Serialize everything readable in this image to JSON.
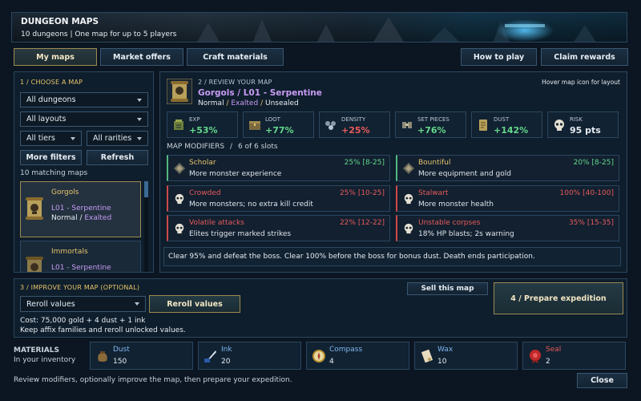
{
  "header": {
    "title": "DUNGEON MAPS",
    "subtitle": "10 dungeons | One map for up to 5 players"
  },
  "tabs": [
    {
      "label": "My maps",
      "active": true
    },
    {
      "label": "Market offers",
      "active": false
    },
    {
      "label": "Craft materials",
      "active": false
    }
  ],
  "top_actions": {
    "how_to_play": "How to play",
    "claim_rewards": "Claim rewards"
  },
  "choose": {
    "title": "1 / CHOOSE A MAP",
    "dungeons": "All dungeons",
    "layouts": "All layouts",
    "tiers": "All tiers",
    "rarities": "All rarities",
    "more_filters": "More filters",
    "refresh": "Refresh",
    "count": "10 matching maps",
    "maps": [
      {
        "name": "Gorgols",
        "layout": "L01 - Serpentine",
        "quality": "Normal",
        "sep": "/",
        "rarity": "Exalted",
        "selected": true
      },
      {
        "name": "Immortals",
        "layout": "L01 - Serpentine",
        "selected": false
      }
    ]
  },
  "review": {
    "title": "2 / REVIEW YOUR MAP",
    "hint": "Hover map icon for layout",
    "map_name": "Gorgols / L01 - Serpentine",
    "tags": [
      "Normal",
      "Exalted",
      "Unsealed"
    ],
    "sep": "/",
    "stats": [
      {
        "label": "EXP",
        "value": "+53%",
        "icon": "exp-icon"
      },
      {
        "label": "LOOT",
        "value": "+77%",
        "icon": "loot-icon"
      },
      {
        "label": "DENSITY",
        "value": "+25%",
        "icon": "density-icon"
      },
      {
        "label": "SET PIECES",
        "value": "+76%",
        "icon": "set-pieces-icon"
      },
      {
        "label": "DUST",
        "value": "+142%",
        "icon": "dust-icon"
      },
      {
        "label": "RISK",
        "value": "95 pts",
        "icon": "skull-icon"
      }
    ],
    "modifiers_title": "MAP MODIFIERS",
    "modifiers_slots": "6 of 6 slots",
    "modifiers": [
      {
        "name": "Scholar",
        "desc": "More monster experience",
        "range": "25% [8-25]",
        "kind": "good"
      },
      {
        "name": "Bountiful",
        "desc": "More equipment and gold",
        "range": "20% [8-25]",
        "kind": "good"
      },
      {
        "name": "Crowded",
        "desc": "More monsters; no extra kill credit",
        "range": "25% [10-25]",
        "kind": "bad"
      },
      {
        "name": "Stalwart",
        "desc": "More monster health",
        "range": "100% [40-100]",
        "kind": "bad"
      },
      {
        "name": "Volatile attacks",
        "desc": "Elites trigger marked strikes",
        "range": "22% [12-22]",
        "kind": "bad"
      },
      {
        "name": "Unstable corpses",
        "desc": "18% HP blasts; 2s warning",
        "range": "35% [15-35]",
        "kind": "bad"
      }
    ],
    "objective": "Clear 95% and defeat the boss. Clear 100% before the boss for bonus dust. Death ends participation."
  },
  "improve": {
    "title": "3 / IMPROVE YOUR MAP (OPTIONAL)",
    "option": "Reroll values",
    "action": "Reroll values",
    "cost": "Cost: 75,000 gold + 4 dust + 1 ink",
    "note": "Keep affix families and reroll unlocked values.",
    "sell": "Sell this map",
    "prepare": "4 / Prepare expedition"
  },
  "materials": {
    "title": "MATERIALS",
    "subtitle": "In your inventory",
    "items": [
      {
        "name": "Dust",
        "count": "150",
        "icon": "dust-pouch-icon"
      },
      {
        "name": "Ink",
        "count": "20",
        "icon": "ink-quill-icon"
      },
      {
        "name": "Compass",
        "count": "4",
        "icon": "compass-icon"
      },
      {
        "name": "Wax",
        "count": "10",
        "icon": "wax-scroll-icon"
      },
      {
        "name": "Seal",
        "count": "2",
        "icon": "seal-icon"
      }
    ]
  },
  "footer": {
    "hint": "Review modifiers, optionally improve the map, then prepare your expedition.",
    "close": "Close"
  },
  "colors": {
    "gold": "#e7c46a",
    "exalted": "#c79cf5",
    "positive": "#64d88a",
    "negative": "#e85a5a",
    "material": "#7fb7f0"
  }
}
